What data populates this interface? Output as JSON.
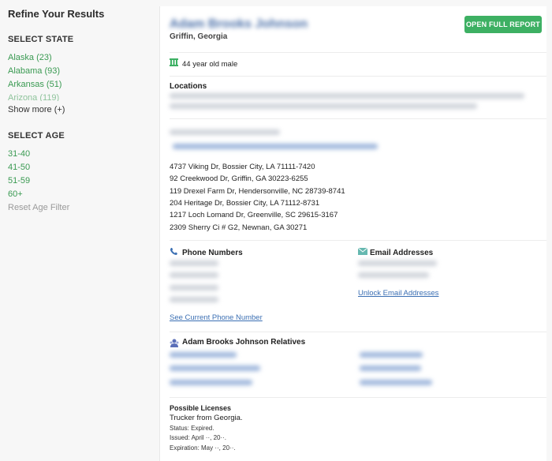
{
  "sidebar": {
    "title": "Refine Your Results",
    "state_heading": "SELECT STATE",
    "states": [
      {
        "label": "Alaska (23)"
      },
      {
        "label": "Alabama (93)"
      },
      {
        "label": "Arkansas (51)"
      },
      {
        "label": "Arizona (119)"
      }
    ],
    "show_more": "Show more (+)",
    "age_heading": "SELECT AGE",
    "ages": [
      {
        "label": "31-40"
      },
      {
        "label": "41-50"
      },
      {
        "label": "51-59"
      },
      {
        "label": "60+"
      }
    ],
    "reset_age": "Reset Age Filter"
  },
  "profile": {
    "name": "Adam Brooks Johnson",
    "location": "Griffin, Georgia",
    "open_report": "OPEN FULL REPORT",
    "age_desc": "44 year old male"
  },
  "locations": {
    "title": "Locations",
    "addresses": [
      "4737 Viking Dr, Bossier City, LA 71111-7420",
      "92 Creekwood Dr, Griffin, GA 30223-6255",
      "119 Drexel Farm Dr, Hendersonville, NC 28739-8741",
      "204 Heritage Dr, Bossier City, LA 71112-8731",
      "1217 Loch Lomand Dr, Greenville, SC 29615-3167",
      "2309 Sherry Ci # G2, Newnan, GA 30271"
    ]
  },
  "phones": {
    "title": "Phone Numbers",
    "see_current": "See Current Phone Number"
  },
  "emails": {
    "title": "Email Addresses",
    "unlock": "Unlock Email Addresses"
  },
  "relatives": {
    "title": "Adam Brooks Johnson Relatives"
  },
  "licenses": {
    "title": "Possible Licenses",
    "desc": "Trucker from Georgia.",
    "status": "Status: Expired.",
    "issued": "Issued: April ··, 20··.",
    "expiration": "Expiration: May ··, 20··."
  },
  "colors": {
    "accent_green": "#3db063",
    "link_blue": "#3b6fb3"
  }
}
